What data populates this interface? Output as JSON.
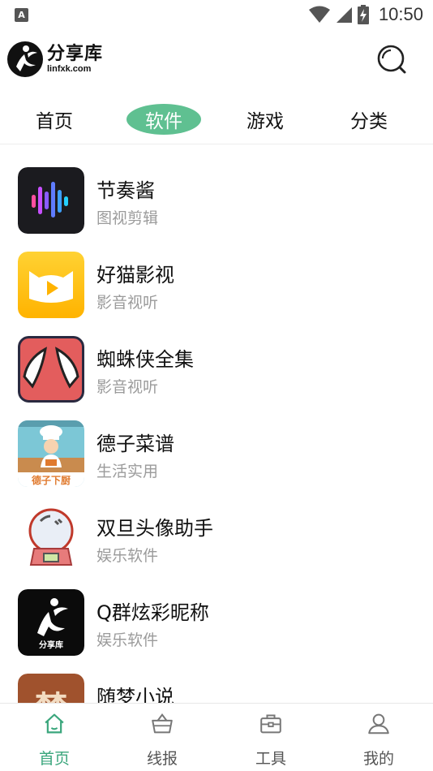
{
  "status_bar": {
    "notification_icon": "A",
    "time": "10:50",
    "icons": [
      "wifi-icon",
      "signal-icon",
      "battery-charging-icon"
    ]
  },
  "header": {
    "logo_name": "分享库",
    "logo_url": "linfxk.com",
    "search_icon": "search-icon"
  },
  "tabs": [
    {
      "label": "首页",
      "active": false
    },
    {
      "label": "软件",
      "active": true
    },
    {
      "label": "游戏",
      "active": false
    },
    {
      "label": "分类",
      "active": false
    }
  ],
  "accent_color": "#5fc091",
  "apps": [
    {
      "name": "节奏酱",
      "category": "图视剪辑",
      "icon": "audio-wave-icon"
    },
    {
      "name": "好猫影视",
      "category": "影音视听",
      "icon": "cat-play-icon"
    },
    {
      "name": "蜘蛛侠全集",
      "category": "影音视听",
      "icon": "spider-mask-icon"
    },
    {
      "name": "德子菜谱",
      "category": "生活实用",
      "icon": "chef-icon",
      "icon_text": "德子下厨"
    },
    {
      "name": "双旦头像助手",
      "category": "娱乐软件",
      "icon": "snow-globe-icon"
    },
    {
      "name": "Q群炫彩昵称",
      "category": "娱乐软件",
      "icon": "fenxiangku-logo-icon",
      "icon_text": "分享库"
    },
    {
      "name": "随梦小说",
      "category": "",
      "icon": "novel-icon",
      "icon_text": "梦"
    }
  ],
  "bottom_nav": [
    {
      "label": "首页",
      "icon": "home-icon",
      "active": true
    },
    {
      "label": "线报",
      "icon": "basket-icon",
      "active": false
    },
    {
      "label": "工具",
      "icon": "toolbox-icon",
      "active": false
    },
    {
      "label": "我的",
      "icon": "user-icon",
      "active": false
    }
  ]
}
